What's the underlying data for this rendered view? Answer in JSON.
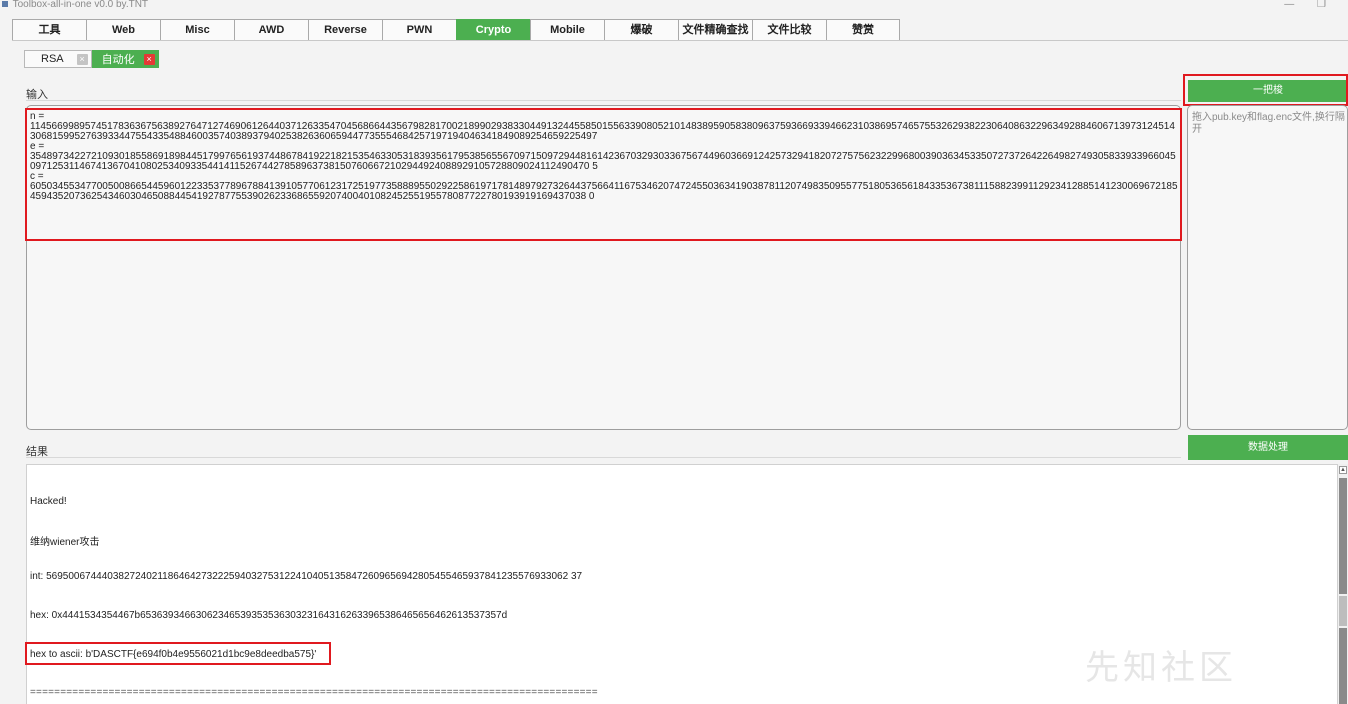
{
  "window": {
    "title": "Toolbox-all-in-one v0.0 by.TNT",
    "minimize": "—",
    "restore": "❐"
  },
  "main_tabs": [
    {
      "label": "工具"
    },
    {
      "label": "Web"
    },
    {
      "label": "Misc"
    },
    {
      "label": "AWD"
    },
    {
      "label": "Reverse"
    },
    {
      "label": "PWN"
    },
    {
      "label": "Crypto"
    },
    {
      "label": "Mobile"
    },
    {
      "label": "爆破"
    },
    {
      "label": "文件精确查找"
    },
    {
      "label": "文件比较"
    },
    {
      "label": "赞赏"
    }
  ],
  "active_main_tab": "Crypto",
  "sub_tabs": [
    {
      "label": "RSA",
      "close": "×"
    },
    {
      "label": "自动化",
      "close": "×"
    }
  ],
  "active_sub_tab": "自动化",
  "input_section": {
    "label": "输入",
    "text": "n =\n11456699895745178363675638927647127469061264403712633547045686644356798281700218990293833044913244558501556339080521014838959058380963759366933946623103869574657553262938223064086322963492884606713973124514306815995276393344755433548846003574038937940253826360659447735554684257197194046341849089254659225497\ne =\n3548973422721093018558691898445179976561937448678419221821535463305318393561795385655670971509729448161423670329303367567449603669124257329418207275756232299680039036345335072737264226498274930583393396604509712531146741367041080253409335441411526744278589637381507606672102944924088929105728809024112490470 5\nc =\n6050345534770050086654459601223353778967884139105770612317251977358889550292258619717814897927326443756641167534620747245503634190387811207498350955775180536561843353673811158823991129234128851412300696721854594352073625434603046508844541927877553902623368655920740040108245255195578087722780193919169437038 0"
  },
  "action_button": {
    "label": "一把梭"
  },
  "side_hint": "拖入pub.key和flag.enc文件,换行隔开",
  "result_section": {
    "label": "结果",
    "button_label": "数据处理"
  },
  "results": {
    "status": "Hacked!",
    "attack": "维纳wiener攻击",
    "int_line": "int:  5695006744403827240211864642732225940327531224104051358472609656942805455465937841235576933062 37",
    "hex_line": "hex:  0x4441534354467b65363934663062346539353536303231643162633965386465656462613537357d",
    "ascii_line": "hex to ascii:  b'DASCTF{e694f0b4e9556021d1bc9e8deedba575}'",
    "separator": "=============================================================================================="
  },
  "watermark": "先知社区",
  "colors": {
    "accent": "#4caf50",
    "highlight": "#e0191f",
    "close_active": "#e53935"
  }
}
